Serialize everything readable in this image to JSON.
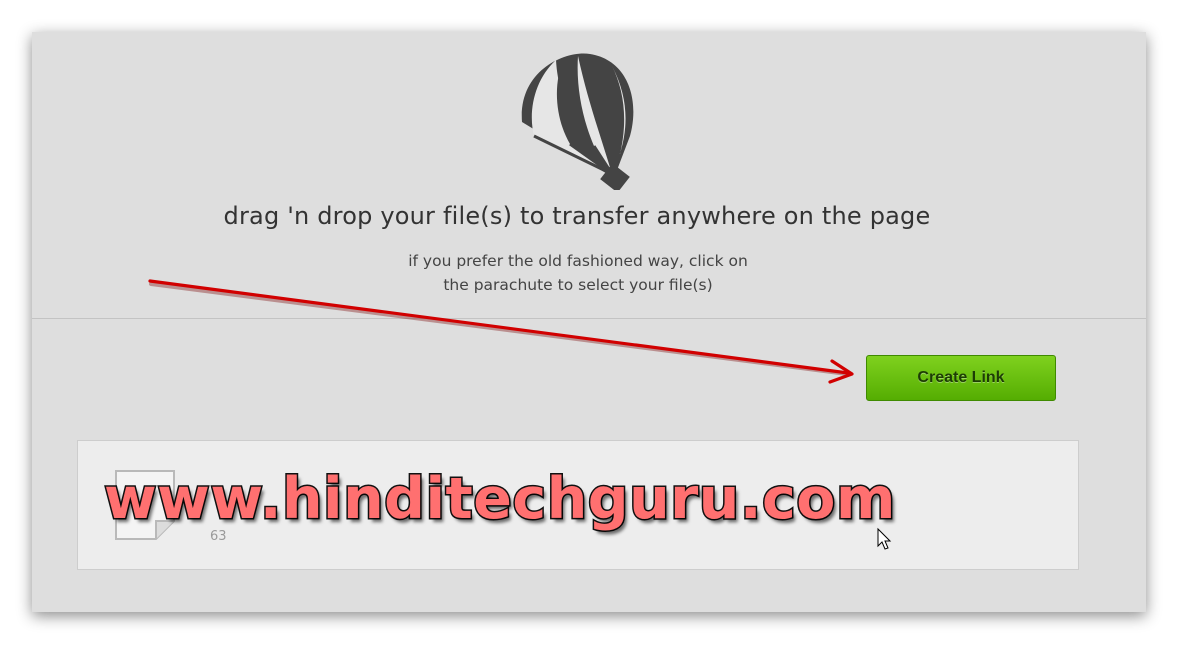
{
  "upload": {
    "headline": "drag 'n drop your file(s) to transfer anywhere on the page",
    "subline_1": "if you prefer the old fashioned way, click on",
    "subline_2": "the parachute to select your file(s)",
    "icon": "parachute-icon"
  },
  "actions": {
    "create_link_label": "Create Link",
    "button_color": "#66bf0a"
  },
  "file_list": {
    "items": [
      {
        "icon": "file-icon",
        "size_text": "63"
      }
    ]
  },
  "watermark": {
    "text": "www.hinditechguru.com",
    "color": "#ff7070"
  },
  "annotation": {
    "arrow_color": "#d10000"
  }
}
